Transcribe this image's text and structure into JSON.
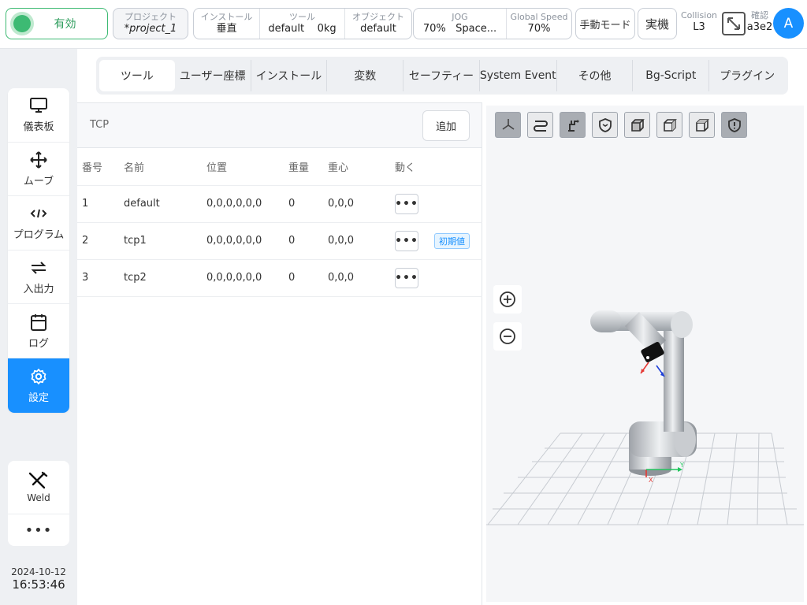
{
  "topbar": {
    "enable_label": "有効",
    "project": {
      "label": "プロジェクト",
      "value": "*project_1"
    },
    "install": {
      "label": "インストール",
      "value": "垂直"
    },
    "tool": {
      "label": "ツール",
      "value": "default",
      "weight": "0kg"
    },
    "object": {
      "label": "オブジェクト",
      "value": "default"
    },
    "jog": {
      "label": "JOG",
      "value": "70%",
      "frame": "Space..."
    },
    "global_speed": {
      "label": "Global Speed",
      "value": "70%"
    },
    "manual_mode": "手動モード",
    "real_machine": "実機",
    "collision": {
      "label": "Collision",
      "value": "L3"
    },
    "confirm": {
      "label": "確認",
      "value": "a3e2"
    },
    "avatar": "A"
  },
  "sidebar": {
    "items": [
      {
        "label": "儀表板",
        "icon": "monitor-icon"
      },
      {
        "label": "ムーブ",
        "icon": "move-icon"
      },
      {
        "label": "プログラム",
        "icon": "code-icon"
      },
      {
        "label": "入出力",
        "icon": "swap-icon"
      },
      {
        "label": "ログ",
        "icon": "calendar-icon"
      },
      {
        "label": "設定",
        "icon": "gear-icon"
      }
    ],
    "weld_label": "Weld",
    "more_label": "•••"
  },
  "clock": {
    "date": "2024-10-12",
    "time": "16:53:46"
  },
  "tabs": [
    "ツール",
    "ユーザー座標",
    "インストール",
    "変数",
    "セーフティー",
    "System Event",
    "その他",
    "Bg-Script",
    "プラグイン"
  ],
  "tcp_panel": {
    "title": "TCP",
    "add_label": "追加",
    "columns": [
      "番号",
      "名前",
      "位置",
      "重量",
      "重心",
      "動く"
    ],
    "rows": [
      {
        "no": "1",
        "name": "default",
        "position": "0,0,0,0,0,0",
        "weight": "0",
        "cog": "0,0,0",
        "badge": ""
      },
      {
        "no": "2",
        "name": "tcp1",
        "position": "0,0,0,0,0,0",
        "weight": "0",
        "cog": "0,0,0",
        "badge": "初期値"
      },
      {
        "no": "3",
        "name": "tcp2",
        "position": "0,0,0,0,0,0",
        "weight": "0",
        "cog": "0,0,0",
        "badge": ""
      }
    ],
    "row_action_label": "•••"
  },
  "viewer": {
    "x_axis_label": "X",
    "y_axis_label": "Y",
    "colors": {
      "accent": "#1890ff",
      "enabled": "#3dba73",
      "x_axis": "#e53935",
      "y_axis": "#22c55e",
      "z_axis": "#1e3fd8"
    }
  }
}
